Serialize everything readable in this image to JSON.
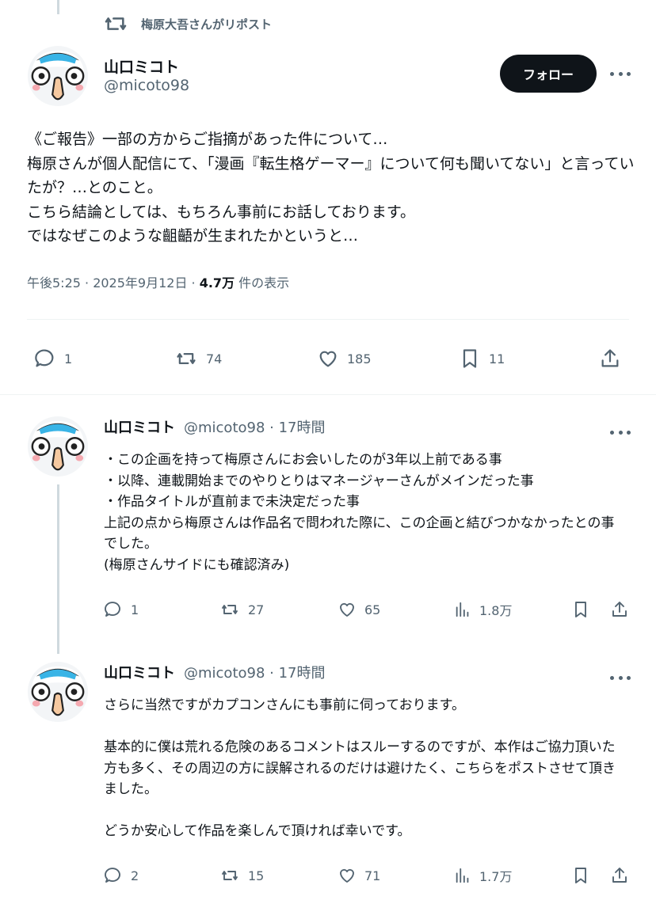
{
  "repost": {
    "label": "梅原大吾さんがリポスト"
  },
  "main": {
    "name": "山口ミコト",
    "handle": "@micoto98",
    "follow_label": "フォロー",
    "text": "《ご報告》一部の方からご指摘があった件について…\n梅原さんが個人配信にて、「漫画『転生格ゲーマー』について何も聞いてない」と言っていたが？…とのこと。\nこちら結論としては、もちろん事前にお話しております。\nではなぜこのような齟齬が生まれたかというと…",
    "time": "午後5:25 · 2025年9月12日 · ",
    "views": "4.7万",
    "views_label": " 件の表示",
    "replies": "1",
    "reposts": "74",
    "likes": "185",
    "bookmarks": "11"
  },
  "replies": [
    {
      "name": "山口ミコト",
      "handle": "@micoto98 · 17時間",
      "text": "・この企画を持って梅原さんにお会いしたのが3年以上前である事\n・以降、連載開始までのやりとりはマネージャーさんがメインだった事\n・作品タイトルが直前まで未決定だった事\n上記の点から梅原さんは作品名で問われた際に、この企画と結びつかなかったとの事でした。\n(梅原さんサイドにも確認済み)",
      "replies": "1",
      "reposts": "27",
      "likes": "65",
      "views": "1.8万"
    },
    {
      "name": "山口ミコト",
      "handle": "@micoto98 · 17時間",
      "text": "さらに当然ですがカプコンさんにも事前に伺っております。\n\n基本的に僕は荒れる危険のあるコメントはスルーするのですが、本作はご協力頂いた方も多く、その周辺の方に誤解されるのだけは避けたく、こちらをポストさせて頂きました。\n\nどうか安心して作品を楽しんで頂ければ幸いです。",
      "replies": "2",
      "reposts": "15",
      "likes": "71",
      "views": "1.7万"
    }
  ],
  "icons": {
    "repost": "repost-icon",
    "reply": "reply-icon",
    "like": "heart-icon",
    "bookmark": "bookmark-icon",
    "share": "share-icon",
    "views": "analytics-icon",
    "more": "more-icon"
  }
}
